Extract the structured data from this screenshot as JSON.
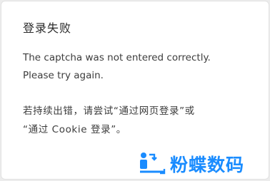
{
  "dialog": {
    "title": "登录失败",
    "message_line1": "The captcha was not entered correctly.",
    "message_line2": "Please try again.",
    "hint_line1": "若持续出错，请尝试“通过网页登录”或",
    "hint_line2": "“通过 Cookie 登录”。"
  },
  "watermark": {
    "text": "粉蝶数码",
    "color": "#1a8cff",
    "icon": "person-transfer-logo"
  }
}
